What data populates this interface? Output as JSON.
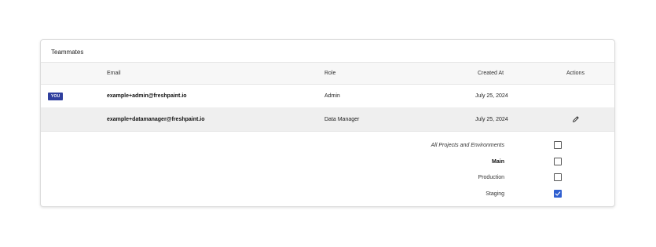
{
  "card": {
    "title": "Teammates"
  },
  "table": {
    "headers": {
      "email": "Email",
      "role": "Role",
      "created_at": "Created At",
      "actions": "Actions"
    },
    "rows": [
      {
        "badge": "YOU",
        "email": "example+admin@freshpaint.io",
        "role": "Admin",
        "created_at": "July 25, 2024",
        "action_icon": ""
      },
      {
        "badge": "",
        "email": "example+datamanager@freshpaint.io",
        "role": "Data Manager",
        "created_at": "July 25, 2024",
        "action_icon": "pencil-icon"
      }
    ]
  },
  "permissions": [
    {
      "label": "All Projects and Environments",
      "style": "italic",
      "checked": false
    },
    {
      "label": "Main",
      "style": "bold",
      "checked": false
    },
    {
      "label": "Production",
      "style": "normal",
      "checked": false
    },
    {
      "label": "Staging",
      "style": "normal",
      "checked": true
    }
  ],
  "colors": {
    "badge_bg": "#2f3f9e",
    "checkbox_checked": "#2f5fd0",
    "selected_row_bg": "#efefef"
  }
}
